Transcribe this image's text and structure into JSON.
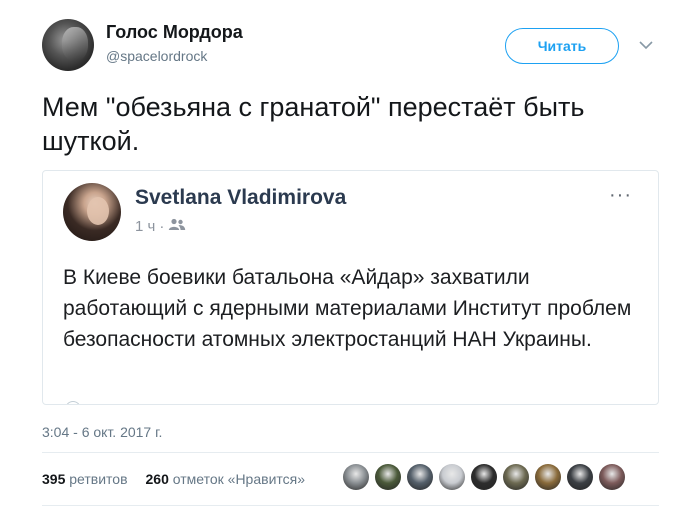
{
  "author": {
    "name": "Голос Мордора",
    "handle": "@spacelordrock"
  },
  "follow_button": {
    "label": "Читать"
  },
  "tweet": {
    "text": "Мем \"обезьяна с гранатой\" перестаёт быть шуткой."
  },
  "embedded_post": {
    "name": "Svetlana Vladimirova",
    "time": "1 ч",
    "separator": "·",
    "privacy_icon": "friends-icon",
    "more": "···",
    "text": "В Киеве боевики батальона «Айдар» захватили работающий с ядерными материалами Институт проблем безопасности атомных электростанций НАН Украины."
  },
  "timestamp": "3:04 - 6 окт. 2017 г.",
  "stats": {
    "retweets_count": "395",
    "retweets_label": "ретвитов",
    "likes_count": "260",
    "likes_label": "отметок «Нравится»"
  },
  "likers": [
    {
      "name": "liker-avatar-1",
      "color": "#8a8f93"
    },
    {
      "name": "liker-avatar-2",
      "color": "#4b5a3a"
    },
    {
      "name": "liker-avatar-3",
      "color": "#55606b"
    },
    {
      "name": "liker-avatar-4",
      "color": "#c9ccd1"
    },
    {
      "name": "liker-avatar-5",
      "color": "#2d2d2d"
    },
    {
      "name": "liker-avatar-6",
      "color": "#6d6a52"
    },
    {
      "name": "liker-avatar-7",
      "color": "#8a6b3b"
    },
    {
      "name": "liker-avatar-8",
      "color": "#3b3f44"
    },
    {
      "name": "liker-avatar-9",
      "color": "#7d5b5b"
    }
  ],
  "colors": {
    "accent": "#1da1f2",
    "secondary_text": "#657786",
    "border": "#e1e8ed"
  }
}
